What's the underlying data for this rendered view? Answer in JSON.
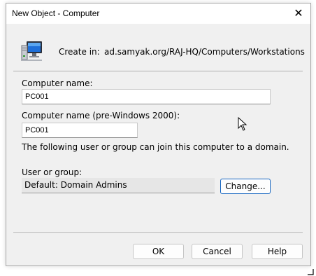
{
  "window": {
    "title": "New Object - Computer",
    "close_symbol": "✕"
  },
  "header": {
    "create_in_label": "Create in:",
    "create_in_path": "ad.samyak.org/RAJ-HQ/Computers/Workstations",
    "icon": "computer-icon"
  },
  "form": {
    "computer_name_label": "Computer name:",
    "computer_name_value": "PC001",
    "pre2000_label": "Computer name (pre-Windows 2000):",
    "pre2000_value": "PC001",
    "info_text": "The following user or group can join this computer to a domain.",
    "user_group_label": "User or group:",
    "user_group_value": "Default: Domain Admins",
    "change_button": "Change..."
  },
  "footer": {
    "ok": "OK",
    "cancel": "Cancel",
    "help": "Help"
  },
  "colors": {
    "dialog_bg": "#f0f0f0",
    "focus_border": "#1565c0",
    "title_bg": "#ffffff"
  }
}
